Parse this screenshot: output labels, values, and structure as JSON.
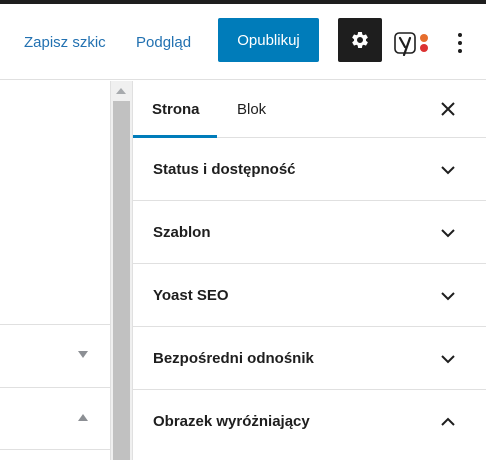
{
  "header": {
    "save_draft_label": "Zapisz szkic",
    "preview_label": "Podgląd",
    "publish_label": "Opublikuj",
    "settings_icon": "gear-icon",
    "yoast_icon": "yoast-seo-icon",
    "more_icon": "more-vertical-icon"
  },
  "sidebar": {
    "tabs": [
      {
        "label": "Strona",
        "active": true
      },
      {
        "label": "Blok",
        "active": false
      }
    ],
    "close_icon": "close-icon",
    "panels": [
      {
        "title": "Status i dostępność",
        "expanded": false
      },
      {
        "title": "Szablon",
        "expanded": false
      },
      {
        "title": "Yoast SEO",
        "expanded": false
      },
      {
        "title": "Bezpośredni odnośnik",
        "expanded": false
      },
      {
        "title": "Obrazek wyróżniający",
        "expanded": true
      }
    ]
  },
  "colors": {
    "accent": "#007cba",
    "link": "#2271b1",
    "dark": "#1e1e1e",
    "border": "#e0e0e0",
    "yoast_orange": "#e66d2d",
    "yoast_red": "#dc3232"
  }
}
